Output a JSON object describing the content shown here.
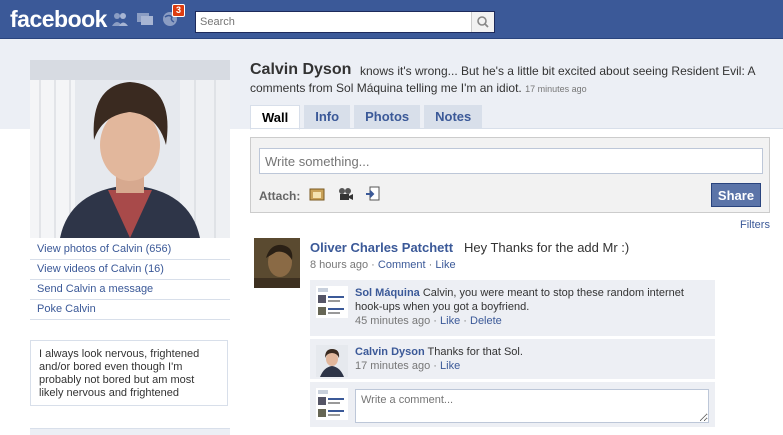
{
  "header": {
    "logo": "facebook",
    "notification_count": "3",
    "search_placeholder": "Search"
  },
  "profile": {
    "name": "Calvin Dyson",
    "status_line1": "knows it's wrong... But he's a little bit excited about seeing Resident Evil: A",
    "status_line2": "comments from Sol Máquina telling me I'm an idiot.",
    "status_time": "17 minutes ago",
    "links": [
      "View photos of Calvin (656)",
      "View videos of Calvin (16)",
      "Send Calvin a message",
      "Poke Calvin"
    ],
    "bio": "I always look nervous, frightened and/or bored even though I'm probably not bored but am most likely nervous and frightened"
  },
  "tabs": [
    "Wall",
    "Info",
    "Photos",
    "Notes"
  ],
  "publisher": {
    "placeholder": "Write something...",
    "attach_label": "Attach:",
    "share_label": "Share"
  },
  "filters_label": "Filters",
  "post": {
    "author": "Oliver Charles Patchett",
    "text": "Hey Thanks for the add Mr :)",
    "time": "8 hours ago",
    "comment_label": "Comment",
    "like_label": "Like",
    "separator": "·"
  },
  "comments": [
    {
      "author": "Sol Máquina",
      "text": "Calvin, you were meant to stop these random internet hook-ups when you got a boyfriend.",
      "time": "45 minutes ago",
      "like": "Like",
      "delete": "Delete"
    },
    {
      "author": "Calvin Dyson",
      "text": "Thanks for that Sol.",
      "time": "17 minutes ago",
      "like": "Like"
    }
  ],
  "comment_box_placeholder": "Write a comment...",
  "colors": {
    "brand": "#3b5998",
    "badge": "#dd3c10",
    "panel": "#edeff4"
  }
}
